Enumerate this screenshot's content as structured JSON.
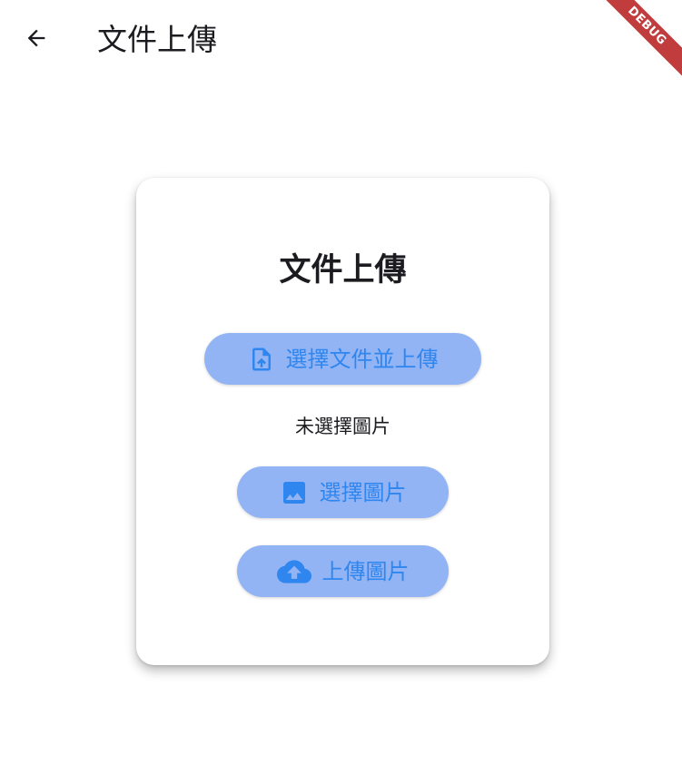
{
  "appbar": {
    "title": "文件上傳",
    "back_icon": "arrow-back-icon"
  },
  "debug_banner": {
    "label": "DEBUG",
    "color": "#b71c1c"
  },
  "card": {
    "title": "文件上傳",
    "file_button": {
      "label": "選擇文件並上傳",
      "icon": "file-upload-icon"
    },
    "status_text": "未選擇圖片",
    "pick_image_button": {
      "label": "選擇圖片",
      "icon": "image-icon"
    },
    "upload_image_button": {
      "label": "上傳圖片",
      "icon": "cloud-upload-icon"
    }
  },
  "colors": {
    "button_background": "#93b4f4",
    "button_foreground": "#2f86ee",
    "text": "#1c1b1f"
  }
}
